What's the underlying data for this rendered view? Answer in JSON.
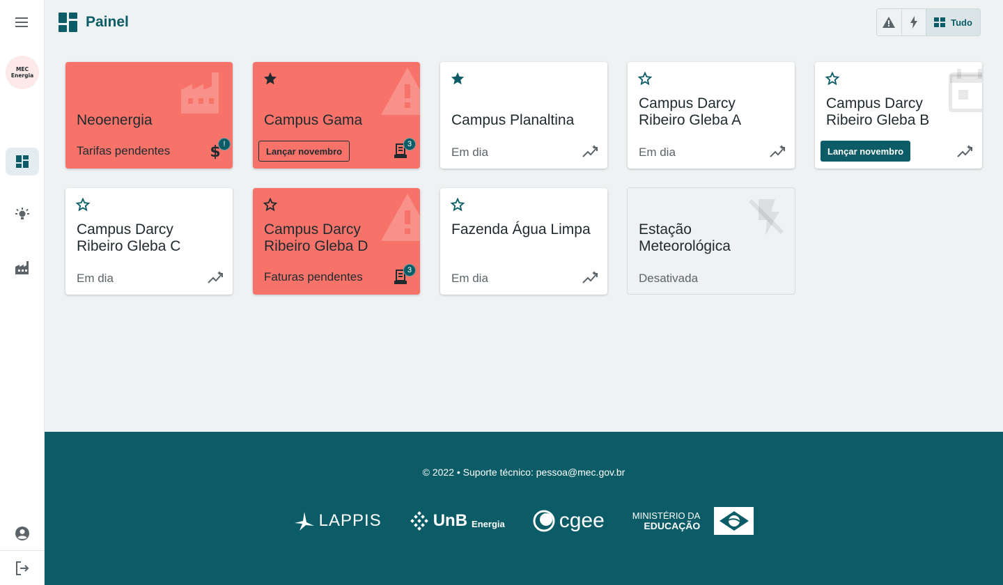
{
  "sidebar": {
    "logo_line1": "MEC",
    "logo_line2": "Energia",
    "icons": [
      "menu-icon",
      "dashboard-icon",
      "lightbulb-icon",
      "factory-icon",
      "account-icon",
      "logout-icon"
    ]
  },
  "header": {
    "title": "Painel",
    "filters": {
      "all_label": "Tudo"
    }
  },
  "cards": [
    {
      "title": "Neoenergia",
      "status": "Tarifas pendentes",
      "badge": "!",
      "variant": "warning"
    },
    {
      "title": "Campus Gama",
      "action": "Lançar novembro",
      "badge": "3",
      "favorite": true,
      "variant": "warning"
    },
    {
      "title": "Campus Planaltina",
      "status": "Em dia",
      "favorite": true,
      "variant": "ok"
    },
    {
      "title": "Campus Darcy Ribeiro Gleba A",
      "status": "Em dia",
      "favorite": false,
      "variant": "ok"
    },
    {
      "title": "Campus Darcy Ribeiro Gleba B",
      "action": "Lançar novembro",
      "favorite": false,
      "variant": "pending"
    },
    {
      "title": "Campus Darcy Ribeiro Gleba C",
      "status": "Em dia",
      "favorite": false,
      "variant": "ok"
    },
    {
      "title": "Campus Darcy Ribeiro Gleba D",
      "status": "Faturas pendentes",
      "badge": "3",
      "favorite": false,
      "variant": "warning"
    },
    {
      "title": "Fazenda Água Limpa",
      "status": "Em dia",
      "favorite": false,
      "variant": "ok"
    },
    {
      "title": "Estação Meteorológica",
      "status": "Desativada",
      "variant": "disabled"
    }
  ],
  "footer": {
    "text": "© 2022  •  Suporte técnico: pessoa@mec.gov.br",
    "logos": {
      "lappis": "LAPPIS",
      "unb": "UnB",
      "unb_sub": "Energia",
      "cgee": "cgee",
      "mec_line1": "MINISTÉRIO DA",
      "mec_line2": "EDUCAÇÃO"
    }
  },
  "colors": {
    "primary": "#0b5c66",
    "warning_card": "#f7736a",
    "background": "#eef2f3"
  }
}
